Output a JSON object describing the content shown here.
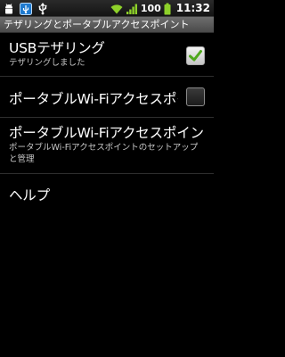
{
  "status_bar": {
    "battery_percent": "100",
    "time": "11:32"
  },
  "title": "テザリングとポータブルアクセスポイント",
  "items": [
    {
      "title": "USBテザリング",
      "summary": "テザリングしました",
      "checked": true
    },
    {
      "title": "ポータブルWi-Fiアクセスポイント",
      "checked": false
    },
    {
      "title": "ポータブルWi-Fiアクセスポイントの設定",
      "summary": "ポータブルWi-Fiアクセスポイントのセットアップと管理"
    },
    {
      "title": "ヘルプ"
    }
  ]
}
